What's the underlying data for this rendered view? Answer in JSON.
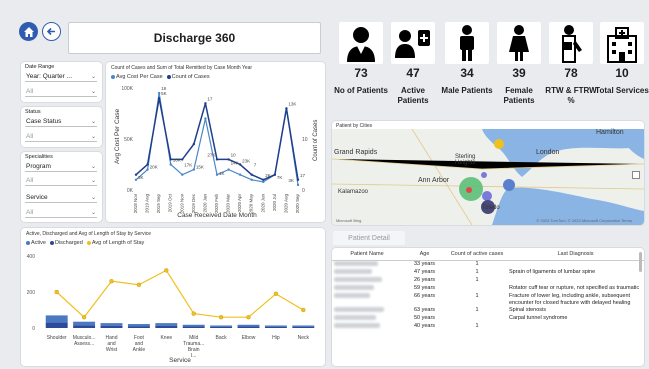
{
  "title": "Discharge 360",
  "filters": {
    "date_range": {
      "label": "Date Range",
      "value": "Year: Quarter ...",
      "sub_value": "All"
    },
    "status": {
      "label": "Status",
      "value": "Case Status",
      "sub_value": "All"
    },
    "specialties": {
      "label": "Specialities",
      "program": "Program",
      "program_value": "All",
      "service": "Service",
      "service_value": "All"
    }
  },
  "kpis": [
    {
      "icon": "doctor-icon",
      "value": "73",
      "label": "No of Patients"
    },
    {
      "icon": "patient-iv-icon",
      "value": "47",
      "label": "Active Patients"
    },
    {
      "icon": "male-icon",
      "value": "34",
      "label": "Male Patients"
    },
    {
      "icon": "female-icon",
      "value": "39",
      "label": "Female Patients"
    },
    {
      "icon": "injured-worker-icon",
      "value": "78",
      "label": "RTW & FTRW %"
    },
    {
      "icon": "hospital-icon",
      "value": "10",
      "label": "Total Services"
    }
  ],
  "line_chart": {
    "title": "Count of Cases and Sum of Total Remitted by Case Month Year",
    "legend": [
      "Avg Cost Per Case",
      "Count of Cases"
    ],
    "ylabel_left": "Avg Cost Per Case",
    "ylabel_right": "Count of Cases",
    "xlabel": "Case Received Date Month",
    "yticks": [
      "100K",
      "50K",
      "0K"
    ],
    "yticks_right": [
      "10",
      "0"
    ]
  },
  "map": {
    "title": "Patient by Cities",
    "labels": [
      "Hamilton",
      "Sterling Heights",
      "Grand Rapids",
      "London",
      "Ann Arbor",
      "Toledo",
      "Kalamazoo"
    ],
    "attribution": "© 2023 TomTom, © 2023 Microsoft Corporation  Terms",
    "brand": "Microsoft Bing"
  },
  "bar_chart": {
    "title": "Active, Discharged and Avg of Length of Stay by Service",
    "legend": [
      "Active",
      "Discharged",
      "Avg of Length of Stay"
    ],
    "xlabel": "Service",
    "yticks": [
      "400",
      "200",
      "0"
    ]
  },
  "patient_detail": {
    "tab": "Patient Detail",
    "columns": [
      "Patient Name",
      "Age",
      "Count of active cases",
      "Last Diagnosis"
    ],
    "rows": [
      {
        "age": "33 years",
        "count": "1",
        "diagnosis": ""
      },
      {
        "age": "47 years",
        "count": "1",
        "diagnosis": "Sprain of ligaments of lumbar spine"
      },
      {
        "age": "26 years",
        "count": "1",
        "diagnosis": ""
      },
      {
        "age": "59 years",
        "count": "",
        "diagnosis": "Rotator cuff tear or rupture, not specified as traumatic"
      },
      {
        "age": "66 years",
        "count": "1",
        "diagnosis": "Fracture of lower leg, including ankle, subsequent encounter for closed fracture with delayed healing"
      },
      {
        "age": "63 years",
        "count": "1",
        "diagnosis": "Spinal stenosis"
      },
      {
        "age": "50 years",
        "count": "",
        "diagnosis": "Carpal tunnel syndrome"
      },
      {
        "age": "40 years",
        "count": "1",
        "diagnosis": ""
      }
    ]
  },
  "chart_data": [
    {
      "type": "line",
      "title": "Count of Cases and Sum of Total Remitted by Case Month Year",
      "categories": [
        "2018 Nov",
        "2019 Aug",
        "2019 Sep",
        "2019 Oct",
        "2019 Nov",
        "2019 Dec",
        "2020 Jan",
        "2020 Feb",
        "2020 Mar",
        "2020 Apr",
        "2020 May",
        "2020 Jun",
        "2020 Jul",
        "2020 Aug",
        "2020 Sep"
      ],
      "xlabel": "Case Received Date Month",
      "ylabel": "Avg Cost Per Case",
      "y2label": "Count of Cases",
      "series": [
        {
          "name": "Avg Cost Per Case",
          "values": [
            10,
            20,
            95,
            25,
            15,
            20,
            70,
            15,
            20,
            15,
            10,
            8,
            15,
            80,
            5
          ],
          "color": "#4a86c8"
        },
        {
          "name": "Count of Cases",
          "values": [
            3,
            5,
            18,
            6,
            6,
            9,
            17,
            6,
            6,
            5,
            3,
            2,
            3,
            16,
            2
          ],
          "color": "#1f3f8a"
        }
      ],
      "data_labels": [
        "3K",
        "20K",
        "5K",
        "16K",
        "17K",
        "15K",
        "27K",
        "1K",
        "14K",
        "23K",
        "17",
        "18",
        "10",
        "7",
        "2K",
        "7K",
        "3K",
        "13K",
        "17"
      ],
      "yticks": [
        "100K",
        "50K",
        "0K"
      ]
    },
    {
      "type": "bar",
      "title": "Active, Discharged and Avg of Length of Stay by Service",
      "categories": [
        "Shoulder",
        "Musculo... Assess...",
        "Hand and Wrist",
        "Foot and Ankle",
        "Knee",
        "Mild Trauma... Brain I...",
        "Back",
        "Elbow",
        "Hip",
        "Neck"
      ],
      "xlabel": "Service",
      "series": [
        {
          "name": "Active",
          "values": [
            40,
            20,
            15,
            12,
            15,
            10,
            8,
            10,
            8,
            8
          ],
          "color": "#4a78c2"
        },
        {
          "name": "Discharged",
          "values": [
            30,
            15,
            12,
            10,
            12,
            8,
            6,
            8,
            6,
            6
          ],
          "color": "#2c4a9a"
        },
        {
          "name": "Avg of Length of Stay",
          "values": [
            200,
            60,
            260,
            240,
            320,
            80,
            60,
            60,
            190,
            100
          ],
          "color": "#f0c020"
        }
      ],
      "yticks": [
        "400",
        "200",
        "0"
      ]
    }
  ]
}
